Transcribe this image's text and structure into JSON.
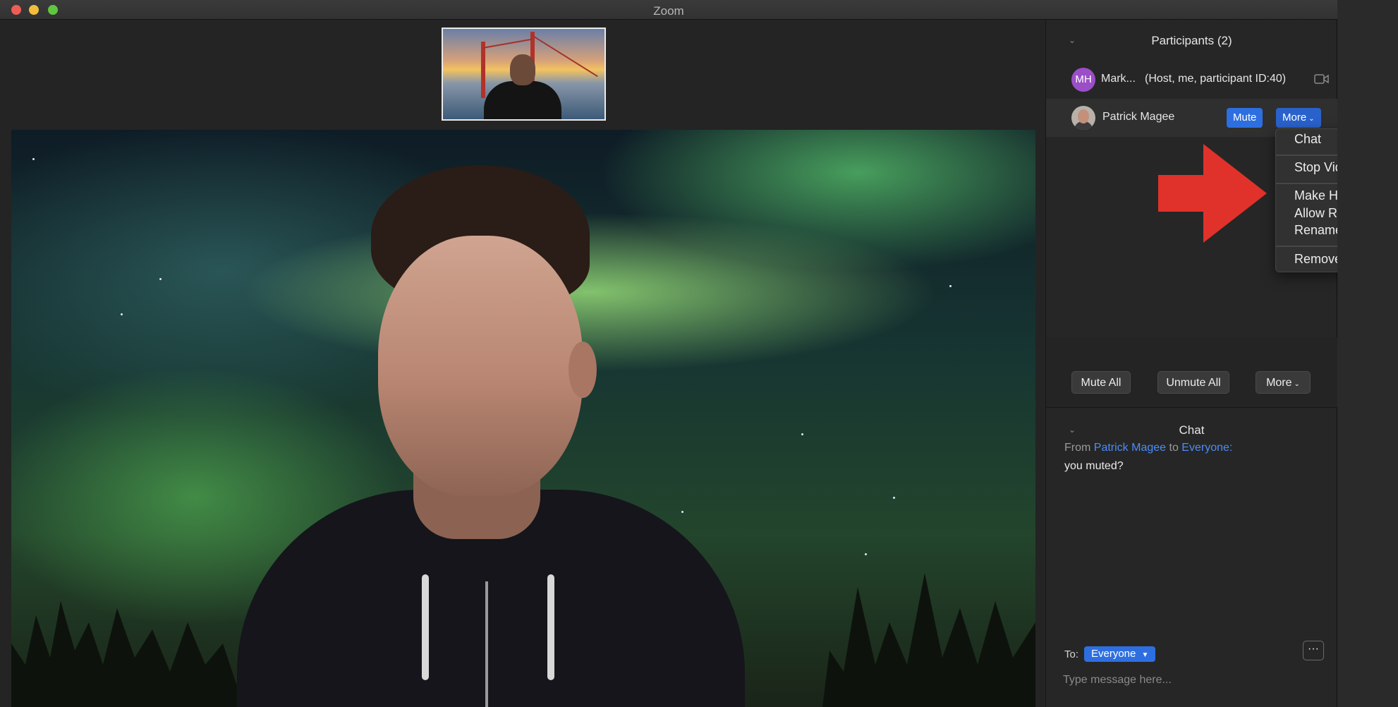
{
  "window": {
    "title": "Zoom"
  },
  "participants": {
    "header": "Participants (2)",
    "rows": [
      {
        "avatar_initials": "MH",
        "name": "Mark...",
        "role": "(Host, me, participant ID:40)"
      },
      {
        "name": "Patrick Magee",
        "mute_label": "Mute",
        "more_label": "More"
      }
    ],
    "context_menu": {
      "items": [
        "Chat",
        "Stop Video",
        "Make Host",
        "Allow Record",
        "Rename",
        "Remove"
      ]
    },
    "actions": {
      "mute_all": "Mute All",
      "unmute_all": "Unmute All",
      "more": "More"
    }
  },
  "chat": {
    "header": "Chat",
    "message": {
      "from_prefix": "From",
      "sender": "Patrick Magee",
      "to_word": "to",
      "recipient": "Everyone:",
      "text": "you muted?"
    },
    "to_label": "To:",
    "to_value": "Everyone",
    "input_placeholder": "Type message here...",
    "more_options": "···"
  },
  "colors": {
    "accent_blue": "#2d6fe0",
    "link_blue": "#4c8cf5",
    "avatar_purple": "#9b4fc6",
    "arrow_red": "#e0322a",
    "panel_bg": "#262626"
  },
  "icons": {
    "collapse": "chevron-down-icon",
    "camera": "video-camera-icon",
    "dropdown": "caret-down-icon"
  }
}
